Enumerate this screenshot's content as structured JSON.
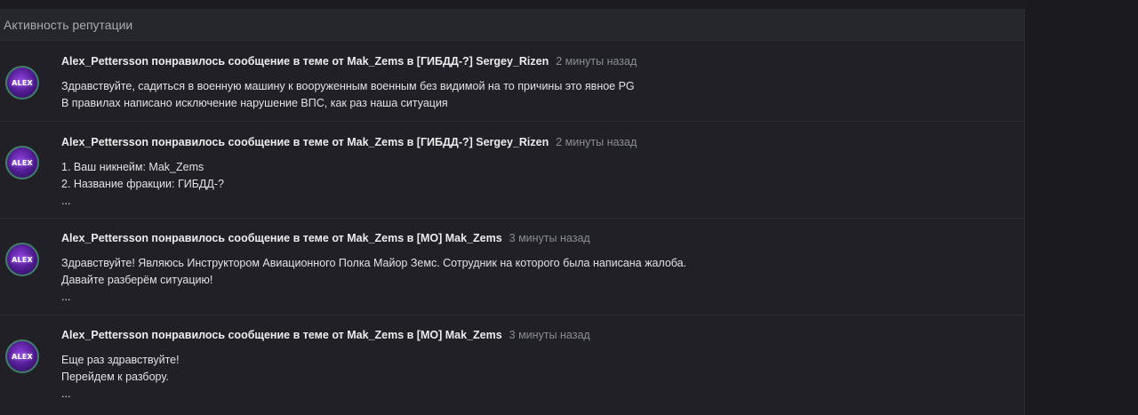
{
  "panel": {
    "title": "Активность репутации"
  },
  "items": [
    {
      "avatar_text": "ALEX",
      "headline": "Alex_Pettersson понравилось сообщение в теме от Mak_Zems в [ГИБДД-?] Sergey_Rizen",
      "time": "2 минуты назад",
      "lines": [
        "Здравствуйте, садиться в военную машину к вооруженным военным без видимой на то причины это явное PG",
        "В правилах написано исключение нарушение ВПС, как раз наша ситуация"
      ]
    },
    {
      "avatar_text": "ALEX",
      "headline": "Alex_Pettersson понравилось сообщение в теме от Mak_Zems в [ГИБДД-?] Sergey_Rizen",
      "time": "2 минуты назад",
      "lines": [
        "1. Ваш никнейм: Mak_Zems",
        "2. Название фракции: ГИБДД-?",
        "..."
      ]
    },
    {
      "avatar_text": "ALEX",
      "headline": "Alex_Pettersson понравилось сообщение в теме от Mak_Zems в [МО] Mak_Zems",
      "time": "3 минуты назад",
      "lines": [
        "Здравствуйте! Являюсь Инструктором Авиационного Полка Майор Земс. Сотрудник на которого была написана жалоба.",
        "Давайте разберём ситуацию!",
        "..."
      ]
    },
    {
      "avatar_text": "ALEX",
      "headline": "Alex_Pettersson понравилось сообщение в теме от Mak_Zems в [МО] Mak_Zems",
      "time": "3 минуты назад",
      "lines": [
        "Еще раз здравствуйте!",
        "Перейдем к разбору.",
        "..."
      ]
    }
  ]
}
